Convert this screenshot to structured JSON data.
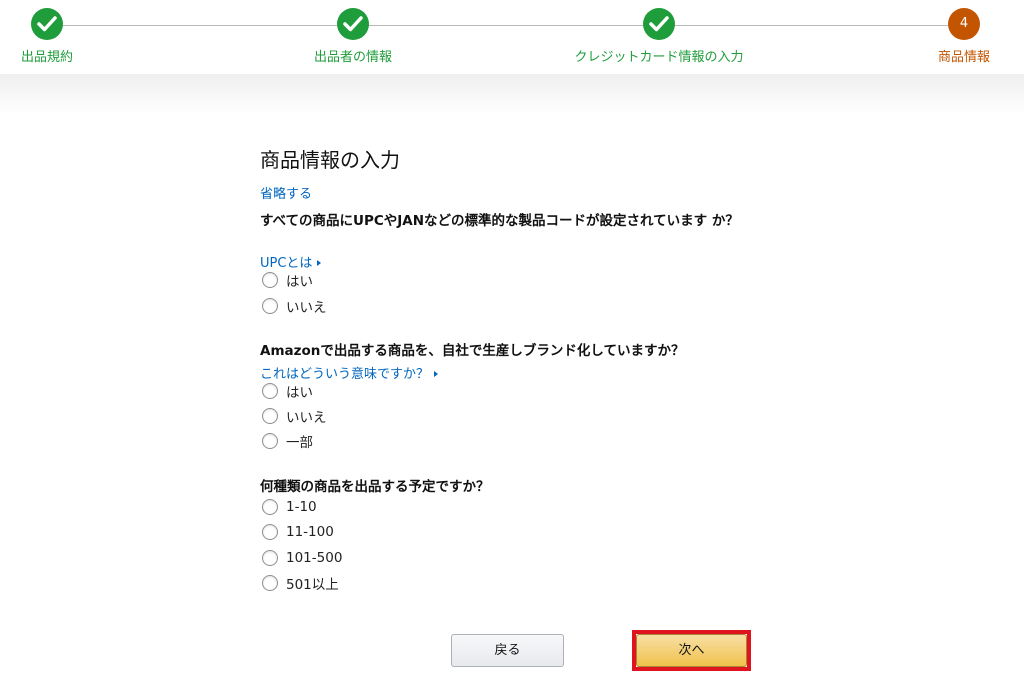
{
  "stepper": {
    "steps": [
      {
        "label": "出品規約",
        "state": "done"
      },
      {
        "label": "出品者の情報",
        "state": "done"
      },
      {
        "label": "クレジットカード情報の入力",
        "state": "done"
      },
      {
        "label": "商品情報",
        "state": "current",
        "number": "4"
      }
    ],
    "colors": {
      "done": "#1f9d3b",
      "current": "#c45500"
    },
    "done_icon": "checkmark-icon"
  },
  "form": {
    "title": "商品情報の入力",
    "skip_link": "省略する",
    "questions": [
      {
        "text": "すべての商品にUPCやJANなどの標準的な製品コードが設定されています か？",
        "help_link": "UPCとは",
        "options": [
          "はい",
          "いいえ"
        ]
      },
      {
        "text": "Amazonで出品する商品を、自社で生産しブランド化していますか？",
        "help_link": "これはどういう意味ですか？",
        "options": [
          "はい",
          "いいえ",
          "一部"
        ]
      },
      {
        "text": "何種類の商品を出品する予定ですか？",
        "options": [
          "1-10",
          "11-100",
          "101-500",
          "501以上"
        ]
      }
    ],
    "link_color": "#0066c0"
  },
  "buttons": {
    "back_label": "戻る",
    "next_label": "次へ",
    "next_color": "#f0c14b",
    "highlight_color": "#e0141e"
  }
}
